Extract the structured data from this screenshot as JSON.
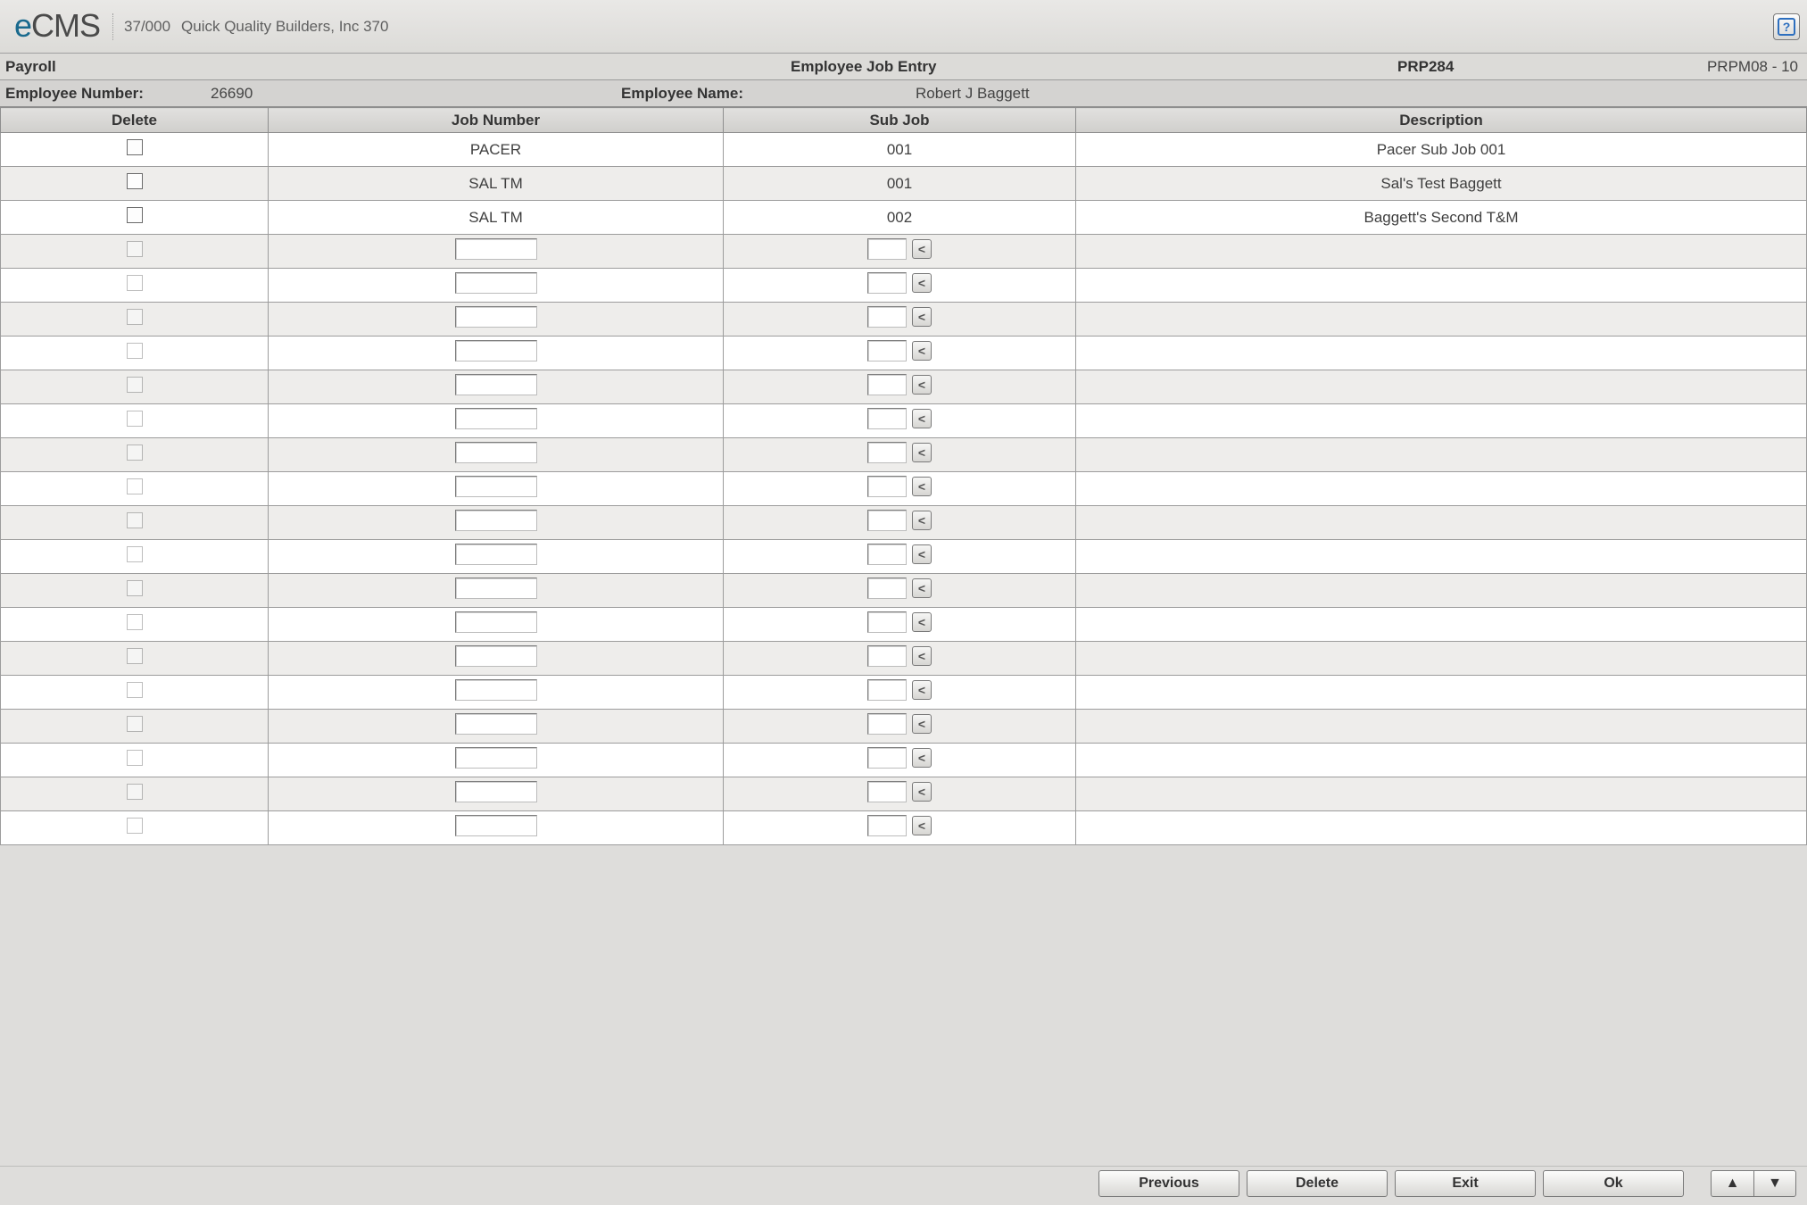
{
  "brand": {
    "e": "e",
    "rest": "CMS"
  },
  "org": {
    "code": "37/000",
    "name": "Quick Quality Builders, Inc 370"
  },
  "screen": {
    "module": "Payroll",
    "title": "Employee Job Entry",
    "code": "PRP284",
    "right": "PRPM08 - 10"
  },
  "employee": {
    "number_label": "Employee Number:",
    "number": "26690",
    "name_label": "Employee Name:",
    "name": "Robert J Baggett"
  },
  "columns": {
    "delete": "Delete",
    "job": "Job Number",
    "sub": "Sub Job",
    "desc": "Description"
  },
  "rows_filled": [
    {
      "job": "PACER",
      "sub": "001",
      "desc": "Pacer Sub Job 001"
    },
    {
      "job": "SAL TM",
      "sub": "001",
      "desc": "Sal's Test Baggett"
    },
    {
      "job": "SAL TM",
      "sub": "002",
      "desc": "Baggett's Second T&M"
    }
  ],
  "empty_row_count": 18,
  "lookup_glyph": "<",
  "footer": {
    "previous": "Previous",
    "delete": "Delete",
    "exit": "Exit",
    "ok": "Ok",
    "up": "▲",
    "down": "▼"
  },
  "help_glyph": "?"
}
